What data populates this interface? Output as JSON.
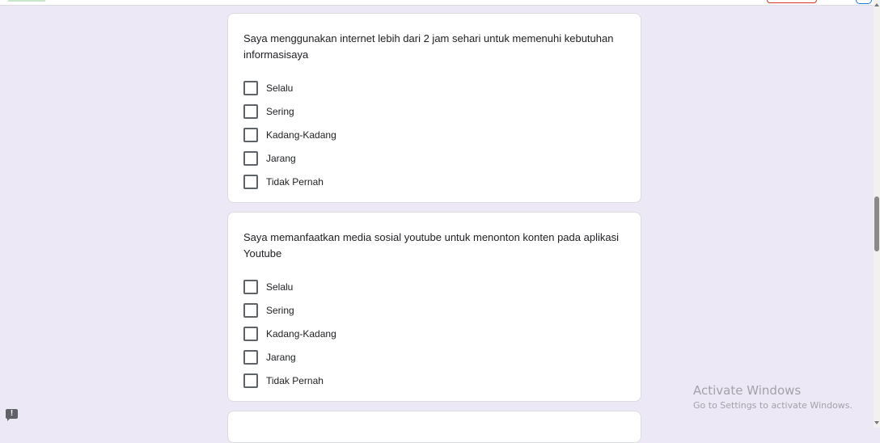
{
  "questions": [
    {
      "text": "Saya menggunakan internet lebih dari 2 jam sehari untuk memenuhi kebutuhan informasisaya",
      "options": [
        "Selalu",
        "Sering",
        "Kadang-Kadang",
        "Jarang",
        "Tidak Pernah"
      ]
    },
    {
      "text": "Saya memanfaatkan media sosial youtube untuk menonton konten pada aplikasi Youtube",
      "options": [
        "Selalu",
        "Sering",
        "Kadang-Kadang",
        "Jarang",
        "Tidak Pernah"
      ]
    }
  ],
  "watermark": {
    "title": "Activate Windows",
    "subtitle": "Go to Settings to activate Windows."
  },
  "feedback_icon": "feedback-icon",
  "colors": {
    "page_background": "#ede8f5",
    "card_background": "#ffffff",
    "checkbox_border": "#5f6368"
  }
}
